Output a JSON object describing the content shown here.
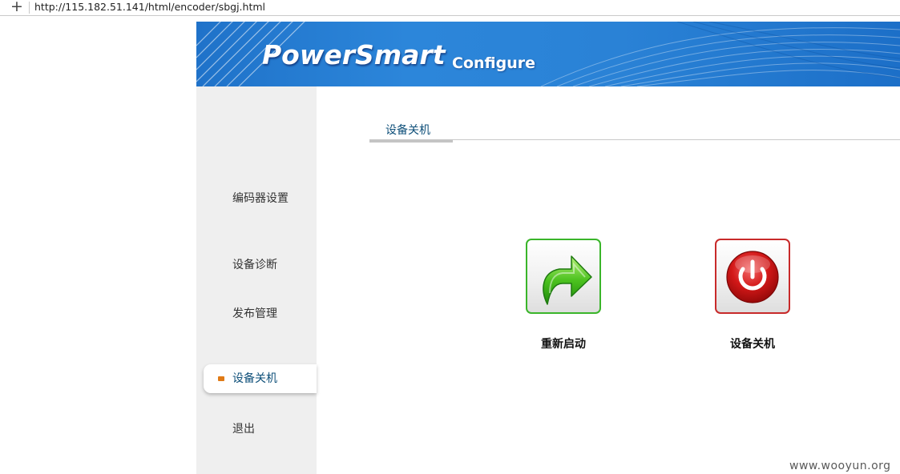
{
  "browser": {
    "new_tab_symbol": "+",
    "url": "http://115.182.51.141/html/encoder/sbgj.html"
  },
  "banner": {
    "logo_text": "PowerSmart",
    "subtitle": "Configure"
  },
  "sidebar": {
    "items": [
      {
        "label": "编码器设置",
        "active": false
      },
      {
        "label": "设备诊断",
        "active": false
      },
      {
        "label": "发布管理",
        "active": false
      },
      {
        "label": "设备关机",
        "active": true
      },
      {
        "label": "退出",
        "active": false
      }
    ]
  },
  "main": {
    "tab_title": "设备关机",
    "actions": [
      {
        "label": "重新启动",
        "icon": "restart-arrow-icon",
        "border_color": "#3ab52a"
      },
      {
        "label": "设备关机",
        "icon": "power-icon",
        "border_color": "#c82a2a"
      }
    ]
  },
  "watermark": "www.wooyun.org",
  "colors": {
    "banner_blue": "#2a82d6",
    "active_marker": "#e07a16",
    "link_text": "#0e4f79",
    "sidebar_bg": "#efefef"
  }
}
